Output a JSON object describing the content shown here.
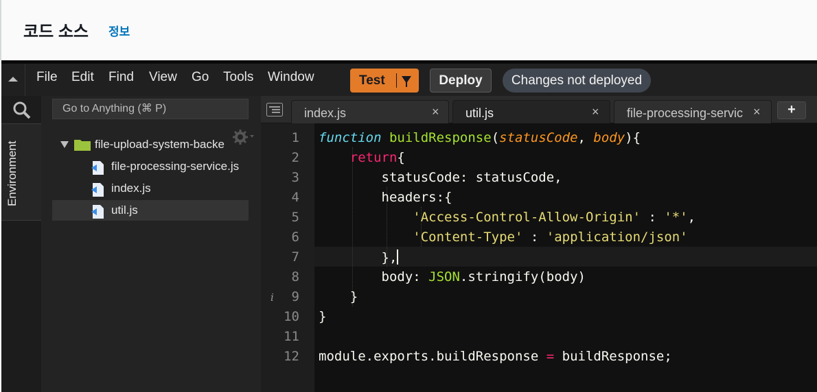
{
  "header": {
    "title": "코드 소스",
    "info": "정보"
  },
  "menu": [
    "File",
    "Edit",
    "Find",
    "View",
    "Go",
    "Tools",
    "Window"
  ],
  "actions": {
    "test": "Test",
    "deploy": "Deploy",
    "status": "Changes not deployed"
  },
  "sidebar": {
    "environment_label": "Environment",
    "goto_placeholder": "Go to Anything (⌘ P)"
  },
  "tree": {
    "folder": "file-upload-system-backe",
    "files": [
      "file-processing-service.js",
      "index.js",
      "util.js"
    ],
    "selected": "util.js"
  },
  "tabs": [
    {
      "label": "index.js",
      "active": false
    },
    {
      "label": "util.js",
      "active": true
    },
    {
      "label": "file-processing-servic",
      "active": false
    }
  ],
  "editor": {
    "line_numbers": [
      "1",
      "2",
      "3",
      "4",
      "5",
      "6",
      "7",
      "8",
      "9",
      "10",
      "11",
      "12"
    ],
    "warning_line": "9",
    "cursor_line": "7",
    "lines": [
      "function buildResponse(statusCode, body){",
      "    return{",
      "        statusCode: statusCode,",
      "        headers:{",
      "            'Access-Control-Allow-Origin' : '*',",
      "            'Content-Type' : 'application/json'",
      "        },",
      "        body: JSON.stringify(body)",
      "    }",
      "}",
      "",
      "module.exports.buildResponse = buildResponse;"
    ]
  },
  "colors": {
    "test_button": "#e47b29",
    "keyword": "#66d9ef",
    "function_name": "#a6e22e",
    "param": "#fd971f",
    "return": "#f92672",
    "string": "#e6db74"
  }
}
